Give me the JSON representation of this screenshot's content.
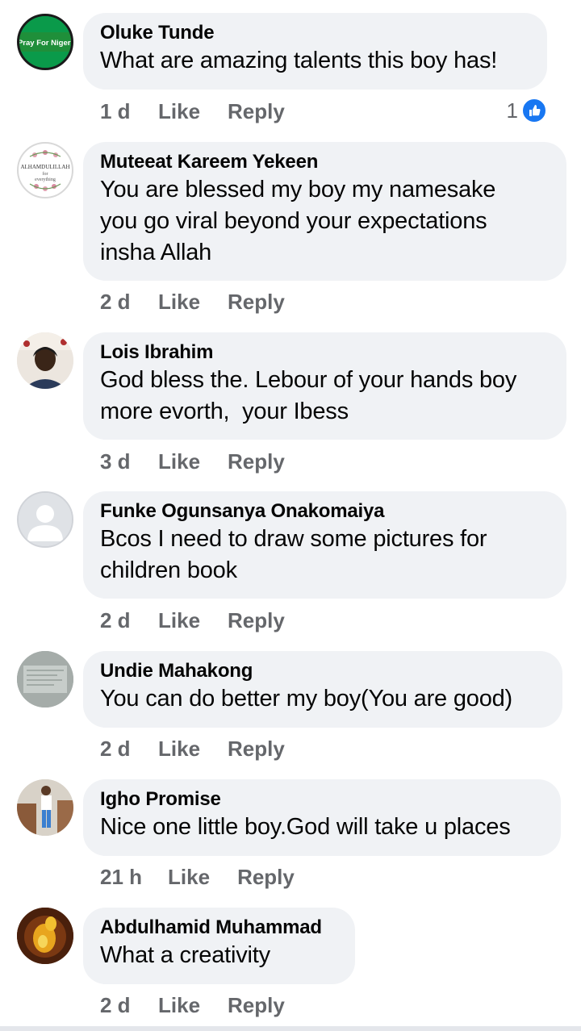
{
  "comments": [
    {
      "author": "Oluke Tunde",
      "text": "What are amazing talents this boy has!",
      "time": "1 d",
      "like_label": "Like",
      "reply_label": "Reply",
      "reaction_count": "1",
      "avatar_text": "#Pray For Nigeria"
    },
    {
      "author": "Muteeat Kareem Yekeen",
      "text": "You are blessed my boy my namesake\nyou go viral beyond your expectations\ninsha Allah",
      "time": "2 d",
      "like_label": "Like",
      "reply_label": "Reply",
      "avatar_text": "ALHAMDULILLAH for everything"
    },
    {
      "author": "Lois Ibrahim",
      "text": "God bless the. Lebour of your hands boy\nmore evorth,  your Ibess",
      "time": "3 d",
      "like_label": "Like",
      "reply_label": "Reply"
    },
    {
      "author": "Funke Ogunsanya Onakomaiya",
      "text": "Bcos I need to draw some pictures for\nchildren book",
      "time": "2 d",
      "like_label": "Like",
      "reply_label": "Reply"
    },
    {
      "author": "Undie Mahakong",
      "text": "You can do better my boy(You are good)",
      "time": "2 d",
      "like_label": "Like",
      "reply_label": "Reply"
    },
    {
      "author": "Igho Promise",
      "text": "Nice one little boy.God will take u places",
      "time": "21 h",
      "like_label": "Like",
      "reply_label": "Reply"
    },
    {
      "author": "Abdulhamid Muhammad",
      "text": "What a creativity",
      "time": "2 d",
      "like_label": "Like",
      "reply_label": "Reply"
    }
  ],
  "colors": {
    "bubble": "#f0f2f5",
    "meta": "#65676b",
    "like_blue": "#1877f2",
    "nigeria_green": "#008751"
  }
}
